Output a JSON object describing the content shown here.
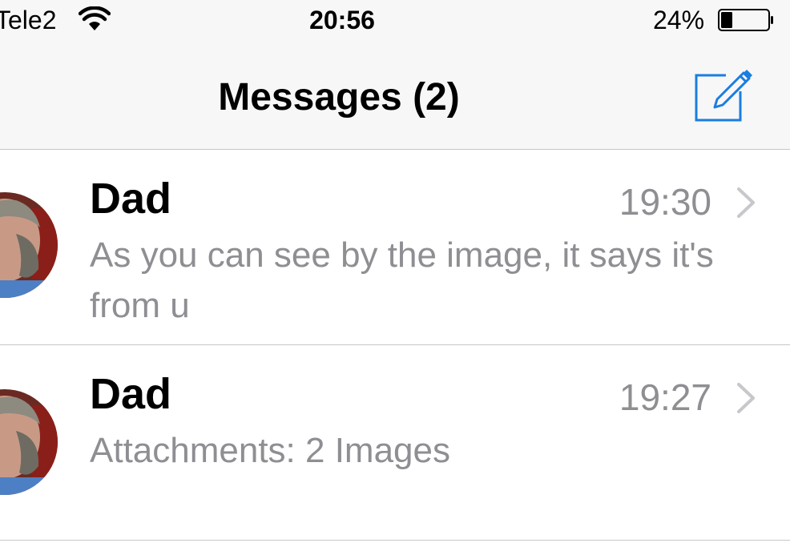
{
  "status_bar": {
    "carrier": "Tele2",
    "time": "20:56",
    "battery_percent": "24%",
    "battery_level": 0.24
  },
  "nav": {
    "title": "Messages (2)",
    "compose_icon": "compose-icon"
  },
  "messages": [
    {
      "sender": "Dad",
      "time": "19:30",
      "preview": "As you can see by the image, it says it's from u"
    },
    {
      "sender": "Dad",
      "time": "19:27",
      "preview": "Attachments: 2 Images"
    }
  ],
  "colors": {
    "accent": "#1a7de0",
    "secondary_text": "#8e8e93",
    "separator": "#c8c7cc",
    "nav_background": "#f7f7f7"
  }
}
